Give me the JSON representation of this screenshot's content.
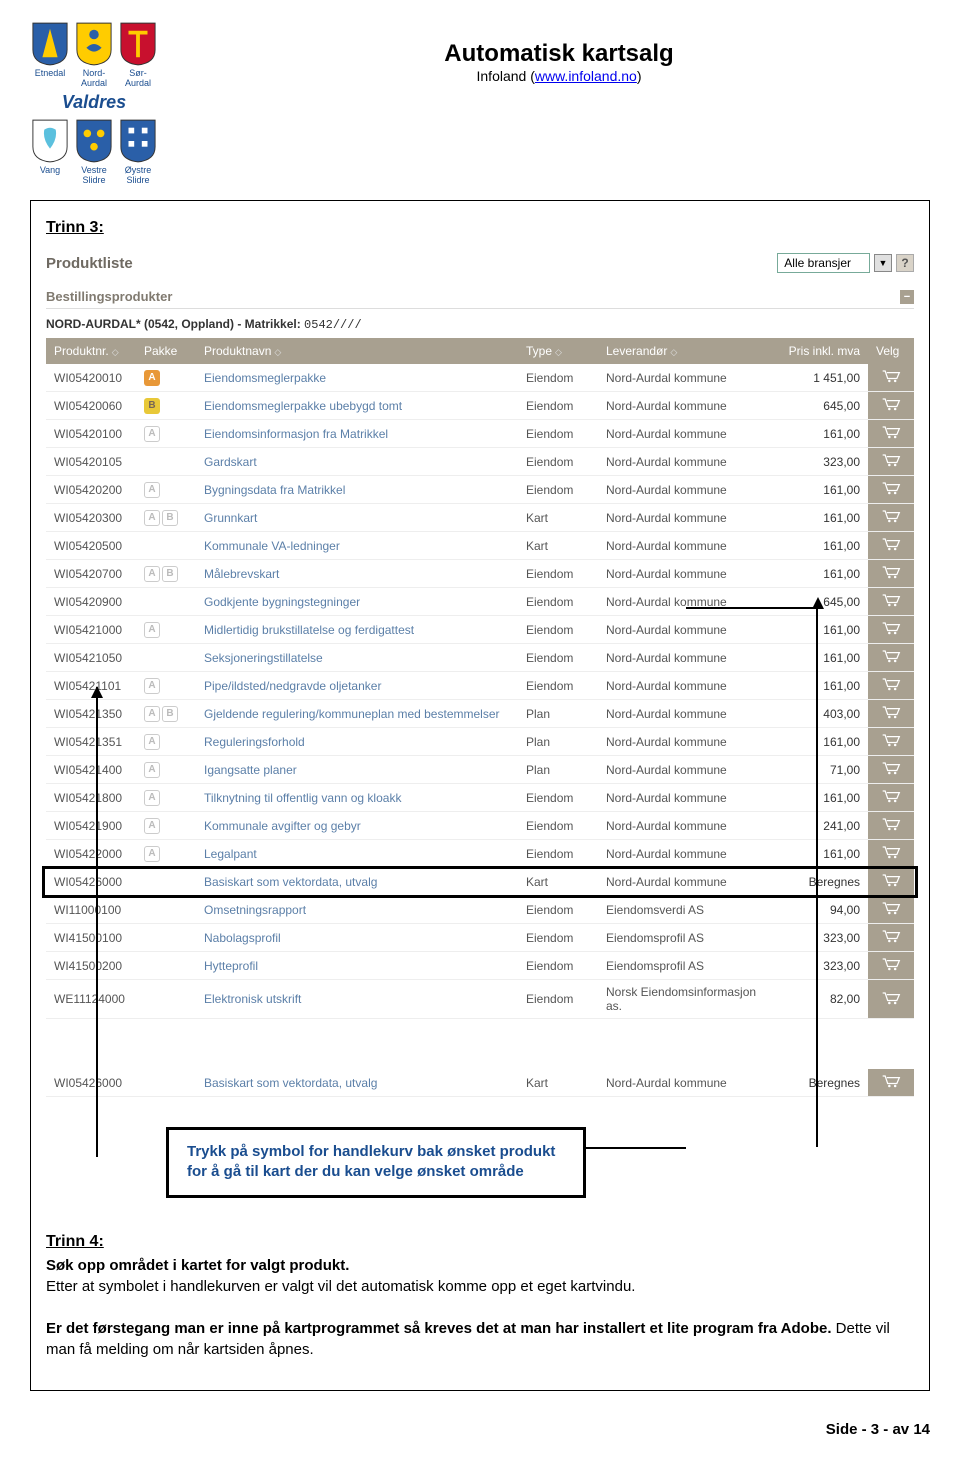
{
  "header": {
    "main_title": "Automatisk kartsalg",
    "sub_prefix": "Infoland (",
    "sub_link_text": "www.infoland.no",
    "sub_suffix": ")",
    "municipalities_top": [
      "Etnedal",
      "Nord-Aurdal",
      "Sør-Aurdal"
    ],
    "municipalities_bottom": [
      "Vang",
      "Vestre Slidre",
      "Øystre Slidre"
    ],
    "region": "Valdres"
  },
  "step3": {
    "heading": "Trinn 3:",
    "produktliste_label": "Produktliste",
    "dropdown_value": "Alle bransjer",
    "section_title": "Bestillingsprodukter",
    "matrikkel_prefix": "NORD-AURDAL* (0542, Oppland) - Matrikkel:",
    "matrikkel_value": "0542////",
    "columns": {
      "produktnr": "Produktnr.",
      "pakke": "Pakke",
      "produktnavn": "Produktnavn",
      "type": "Type",
      "leverandor": "Leverandør",
      "pris": "Pris inkl. mva",
      "velg": "Velg"
    },
    "rows": [
      {
        "nr": "WI05420010",
        "pakke": [
          "A"
        ],
        "navn": "Eiendomsmeglerpakke",
        "type": "Eiendom",
        "lev": "Nord-Aurdal kommune",
        "pris": "1 451,00"
      },
      {
        "nr": "WI05420060",
        "pakke": [
          "B"
        ],
        "navn": "Eiendomsmeglerpakke ubebygd tomt",
        "type": "Eiendom",
        "lev": "Nord-Aurdal kommune",
        "pris": "645,00"
      },
      {
        "nr": "WI05420100",
        "pakke": [
          "Ao"
        ],
        "navn": "Eiendomsinformasjon fra Matrikkel",
        "type": "Eiendom",
        "lev": "Nord-Aurdal kommune",
        "pris": "161,00"
      },
      {
        "nr": "WI05420105",
        "pakke": [],
        "navn": "Gardskart",
        "type": "Eiendom",
        "lev": "Nord-Aurdal kommune",
        "pris": "323,00"
      },
      {
        "nr": "WI05420200",
        "pakke": [
          "Ao"
        ],
        "navn": "Bygningsdata fra Matrikkel",
        "type": "Eiendom",
        "lev": "Nord-Aurdal kommune",
        "pris": "161,00"
      },
      {
        "nr": "WI05420300",
        "pakke": [
          "Ao",
          "Bo"
        ],
        "navn": "Grunnkart",
        "type": "Kart",
        "lev": "Nord-Aurdal kommune",
        "pris": "161,00"
      },
      {
        "nr": "WI05420500",
        "pakke": [],
        "navn": "Kommunale VA-ledninger",
        "type": "Kart",
        "lev": "Nord-Aurdal kommune",
        "pris": "161,00"
      },
      {
        "nr": "WI05420700",
        "pakke": [
          "Ao",
          "Bo"
        ],
        "navn": "Målebrevskart",
        "type": "Eiendom",
        "lev": "Nord-Aurdal kommune",
        "pris": "161,00"
      },
      {
        "nr": "WI05420900",
        "pakke": [],
        "navn": "Godkjente bygningstegninger",
        "type": "Eiendom",
        "lev": "Nord-Aurdal kommune",
        "pris": "645,00"
      },
      {
        "nr": "WI05421000",
        "pakke": [
          "Ao"
        ],
        "navn": "Midlertidig brukstillatelse og ferdigattest",
        "type": "Eiendom",
        "lev": "Nord-Aurdal kommune",
        "pris": "161,00"
      },
      {
        "nr": "WI05421050",
        "pakke": [],
        "navn": "Seksjoneringstillatelse",
        "type": "Eiendom",
        "lev": "Nord-Aurdal kommune",
        "pris": "161,00"
      },
      {
        "nr": "WI05421101",
        "pakke": [
          "Ao"
        ],
        "navn": "Pipe/ildsted/nedgravde oljetanker",
        "type": "Eiendom",
        "lev": "Nord-Aurdal kommune",
        "pris": "161,00"
      },
      {
        "nr": "WI05421350",
        "pakke": [
          "Ao",
          "Bo"
        ],
        "navn": "Gjeldende regulering/kommuneplan med bestemmelser",
        "type": "Plan",
        "lev": "Nord-Aurdal kommune",
        "pris": "403,00"
      },
      {
        "nr": "WI05421351",
        "pakke": [
          "Ao"
        ],
        "navn": "Reguleringsforhold",
        "type": "Plan",
        "lev": "Nord-Aurdal kommune",
        "pris": "161,00"
      },
      {
        "nr": "WI05421400",
        "pakke": [
          "Ao"
        ],
        "navn": "Igangsatte planer",
        "type": "Plan",
        "lev": "Nord-Aurdal kommune",
        "pris": "71,00"
      },
      {
        "nr": "WI05421800",
        "pakke": [
          "Ao"
        ],
        "navn": "Tilknytning til offentlig vann og kloakk",
        "type": "Eiendom",
        "lev": "Nord-Aurdal kommune",
        "pris": "161,00"
      },
      {
        "nr": "WI05421900",
        "pakke": [
          "Ao"
        ],
        "navn": "Kommunale avgifter og gebyr",
        "type": "Eiendom",
        "lev": "Nord-Aurdal kommune",
        "pris": "241,00"
      },
      {
        "nr": "WI05422000",
        "pakke": [
          "Ao"
        ],
        "navn": "Legalpant",
        "type": "Eiendom",
        "lev": "Nord-Aurdal kommune",
        "pris": "161,00"
      },
      {
        "nr": "WI05426000",
        "pakke": [],
        "navn": "Basiskart som vektordata, utvalg",
        "type": "Kart",
        "lev": "Nord-Aurdal kommune",
        "pris": "Beregnes",
        "highlight": true
      },
      {
        "nr": "WI11000100",
        "pakke": [],
        "navn": "Omsetningsrapport",
        "type": "Eiendom",
        "lev": "Eiendomsverdi AS",
        "pris": "94,00"
      },
      {
        "nr": "WI41500100",
        "pakke": [],
        "navn": "Nabolagsprofil",
        "type": "Eiendom",
        "lev": "Eiendomsprofil AS",
        "pris": "323,00"
      },
      {
        "nr": "WI41500200",
        "pakke": [],
        "navn": "Hytteprofil",
        "type": "Eiendom",
        "lev": "Eiendomsprofil AS",
        "pris": "323,00"
      },
      {
        "nr": "WE11124000",
        "pakke": [],
        "navn": "Elektronisk utskrift",
        "type": "Eiendom",
        "lev": "Norsk Eiendomsinformasjon as.",
        "pris": "82,00"
      }
    ],
    "detail_row": {
      "nr": "WI05426000",
      "navn": "Basiskart som vektordata, utvalg",
      "type": "Kart",
      "lev": "Nord-Aurdal kommune",
      "pris": "Beregnes"
    }
  },
  "callout": {
    "text": "Trykk på symbol for handlekurv bak ønsket produkt for å gå til kart der du kan velge ønsket område"
  },
  "step4": {
    "heading": "Trinn 4:",
    "line1": "Søk opp området i kartet for valgt produkt.",
    "line2": "Etter at symbolet i handlekurven er valgt vil det automatisk komme opp et eget kartvindu.",
    "line3a": "Er det førstegang man er inne på kartprogrammet så kreves det at man har installert et lite program fra Adobe.",
    "line3b": " Dette vil man få melding om når kartsiden åpnes."
  },
  "footer": {
    "text": "Side - 3 - av 14"
  }
}
